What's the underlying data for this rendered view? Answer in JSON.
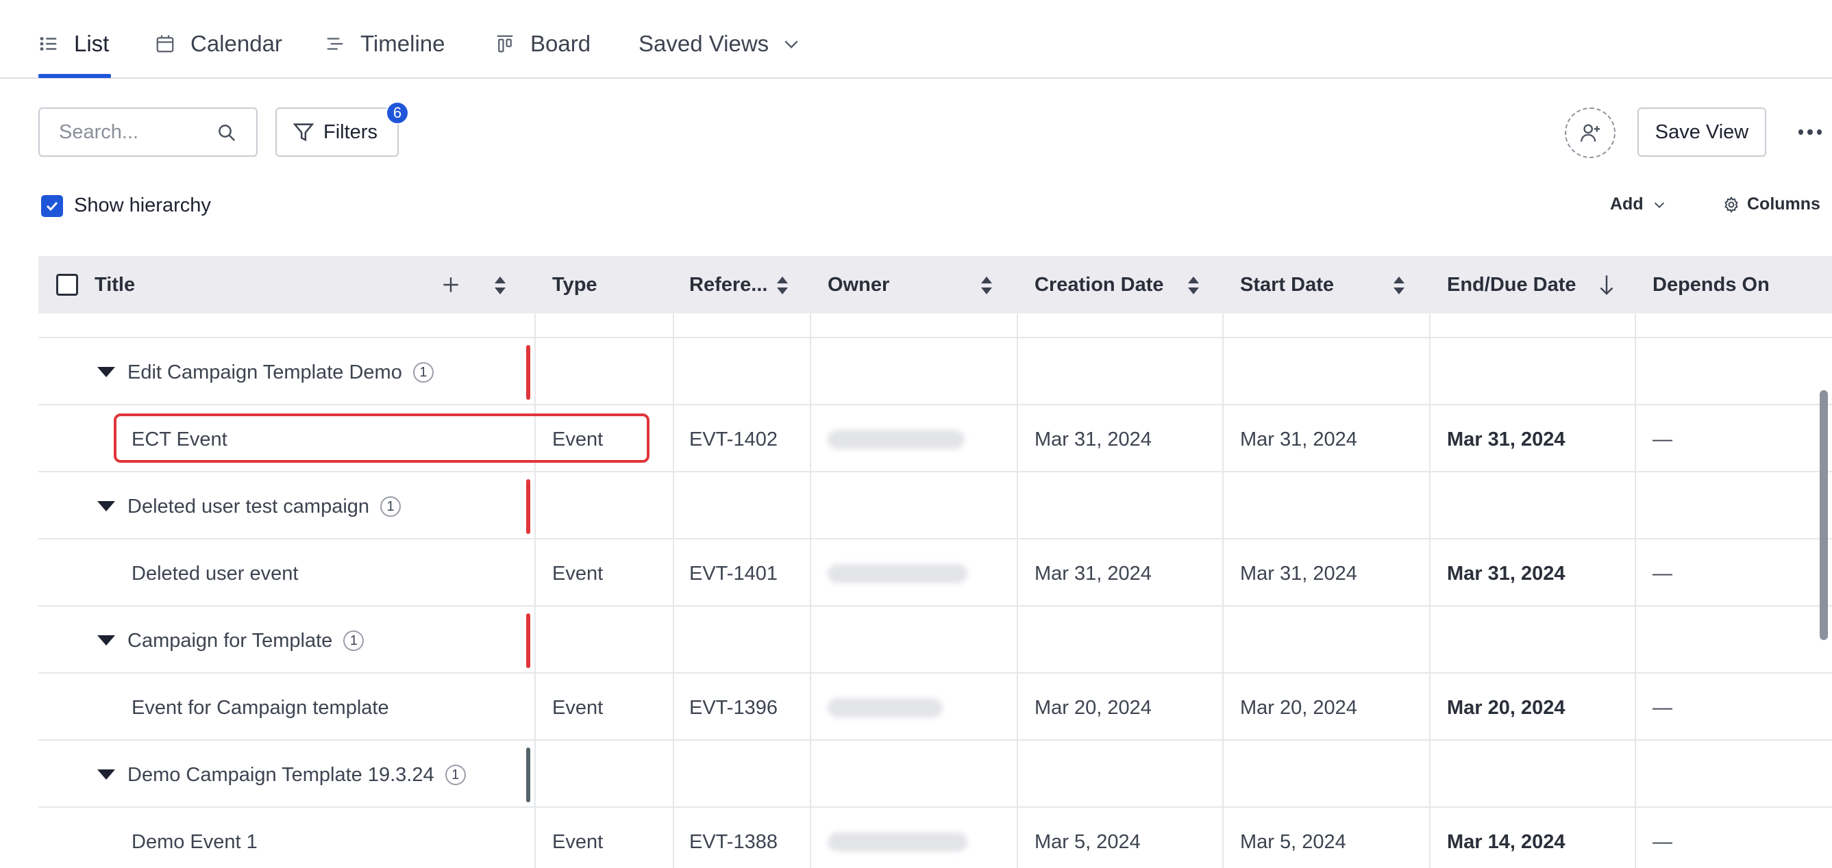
{
  "tabs": [
    {
      "label": "List",
      "icon": "list-icon",
      "active": true
    },
    {
      "label": "Calendar",
      "icon": "calendar-icon"
    },
    {
      "label": "Timeline",
      "icon": "timeline-icon"
    },
    {
      "label": "Board",
      "icon": "board-icon"
    },
    {
      "label": "Saved Views",
      "icon": "chevron-down-icon"
    }
  ],
  "toolbar": {
    "search_placeholder": "Search...",
    "filters_label": "Filters",
    "filters_count": "6",
    "save_view_label": "Save View"
  },
  "options": {
    "show_hierarchy_label": "Show hierarchy",
    "show_hierarchy_checked": true,
    "add_label": "Add",
    "columns_label": "Columns"
  },
  "table": {
    "columns": [
      "Title",
      "Type",
      "Refere...",
      "Owner",
      "Creation Date",
      "Start Date",
      "End/Due Date",
      "Depends On"
    ],
    "rows": [
      {
        "kind": "group",
        "title": "Edit Campaign Template Demo",
        "count": "1",
        "bar_color": "#e0353b"
      },
      {
        "kind": "item",
        "title": "ECT Event",
        "type": "Event",
        "reference": "EVT-1402",
        "creation_date": "Mar 31, 2024",
        "start_date": "Mar 31, 2024",
        "end_date": "Mar 31, 2024",
        "depends_on": "—"
      },
      {
        "kind": "group",
        "title": "Deleted user test campaign",
        "count": "1",
        "bar_color": "#e0353b"
      },
      {
        "kind": "item",
        "title": "Deleted user event",
        "type": "Event",
        "reference": "EVT-1401",
        "creation_date": "Mar 31, 2024",
        "start_date": "Mar 31, 2024",
        "end_date": "Mar 31, 2024",
        "depends_on": "—"
      },
      {
        "kind": "group",
        "title": "Campaign for Template",
        "count": "1",
        "bar_color": "#e0353b"
      },
      {
        "kind": "item",
        "title": "Event for Campaign template",
        "type": "Event",
        "reference": "EVT-1396",
        "creation_date": "Mar 20, 2024",
        "start_date": "Mar 20, 2024",
        "end_date": "Mar 20, 2024",
        "depends_on": "—"
      },
      {
        "kind": "group",
        "title": "Demo Campaign Template 19.3.24",
        "count": "1",
        "bar_color": "#56646b"
      },
      {
        "kind": "item",
        "title": "Demo Event 1",
        "type": "Event",
        "reference": "EVT-1388",
        "creation_date": "Mar 5, 2024",
        "start_date": "Mar 5, 2024",
        "end_date": "Mar 14, 2024",
        "depends_on": "—"
      }
    ]
  },
  "colors": {
    "accent": "#1f56d9",
    "highlight_border": "#e0353b",
    "header_bg": "#ebebf0"
  }
}
